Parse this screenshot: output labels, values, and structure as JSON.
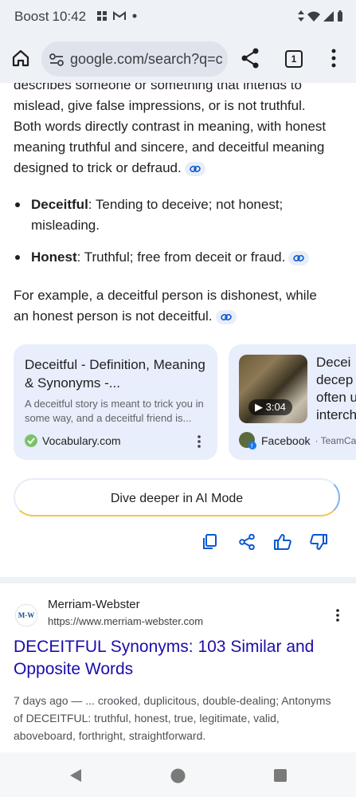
{
  "status_bar": {
    "carrier": "Boost",
    "time": "10:42",
    "icons": [
      "notification-grid-icon",
      "gmail-icon",
      "dot-icon",
      "data-arrows-icon",
      "wifi-icon",
      "signal-icon",
      "battery-icon"
    ]
  },
  "toolbar": {
    "url": "google.com/search?q=c",
    "tab_count": "1",
    "icons": [
      "home-icon",
      "tune-icon",
      "share-icon",
      "menu-icon"
    ]
  },
  "ai_overview": {
    "intro_lines": [
      "describes someone or something that intends to",
      "mislead, give false impressions, or is not truthful.",
      "Both words directly contrast in meaning, with honest",
      "meaning truthful and sincere, and deceitful meaning",
      "designed to trick or defraud."
    ],
    "bullets": [
      {
        "term": "Deceitful",
        "definition": ": Tending to deceive; not honest; misleading."
      },
      {
        "term": "Honest",
        "definition": ": Truthful; free from deceit or fraud."
      }
    ],
    "example": "For example, a deceitful person is dishonest, while an honest person is not deceitful."
  },
  "cards": [
    {
      "title": "Deceitful - Definition, Meaning & Synonyms -...",
      "snippet": "A deceitful story is meant to trick you in some way, and a deceitful friend is...",
      "source": "Vocabulary.com"
    },
    {
      "title_lines": [
        "Decei",
        "decep",
        "often u",
        "interch"
      ],
      "duration": "3:04",
      "source": "Facebook",
      "source_sub": "· TeamCas"
    }
  ],
  "ai_mode_button": "Dive deeper in AI Mode",
  "result": {
    "site_name": "Merriam-Webster",
    "logo_text": "M-W",
    "url": "https://www.merriam-webster.com",
    "title": "DECEITFUL Synonyms: 103 Similar and Opposite Words",
    "snippet": "7 days ago — ... crooked, duplicitous, double-dealing; Antonyms of DECEITFUL: truthful, honest, true, legitimate, valid, aboveboard, forthright, straightforward."
  },
  "colors": {
    "link_blue": "#1a0dab",
    "card_bg": "#e8eefb",
    "chrome_bg": "#eef1f6",
    "action_blue": "#0b57d0"
  }
}
